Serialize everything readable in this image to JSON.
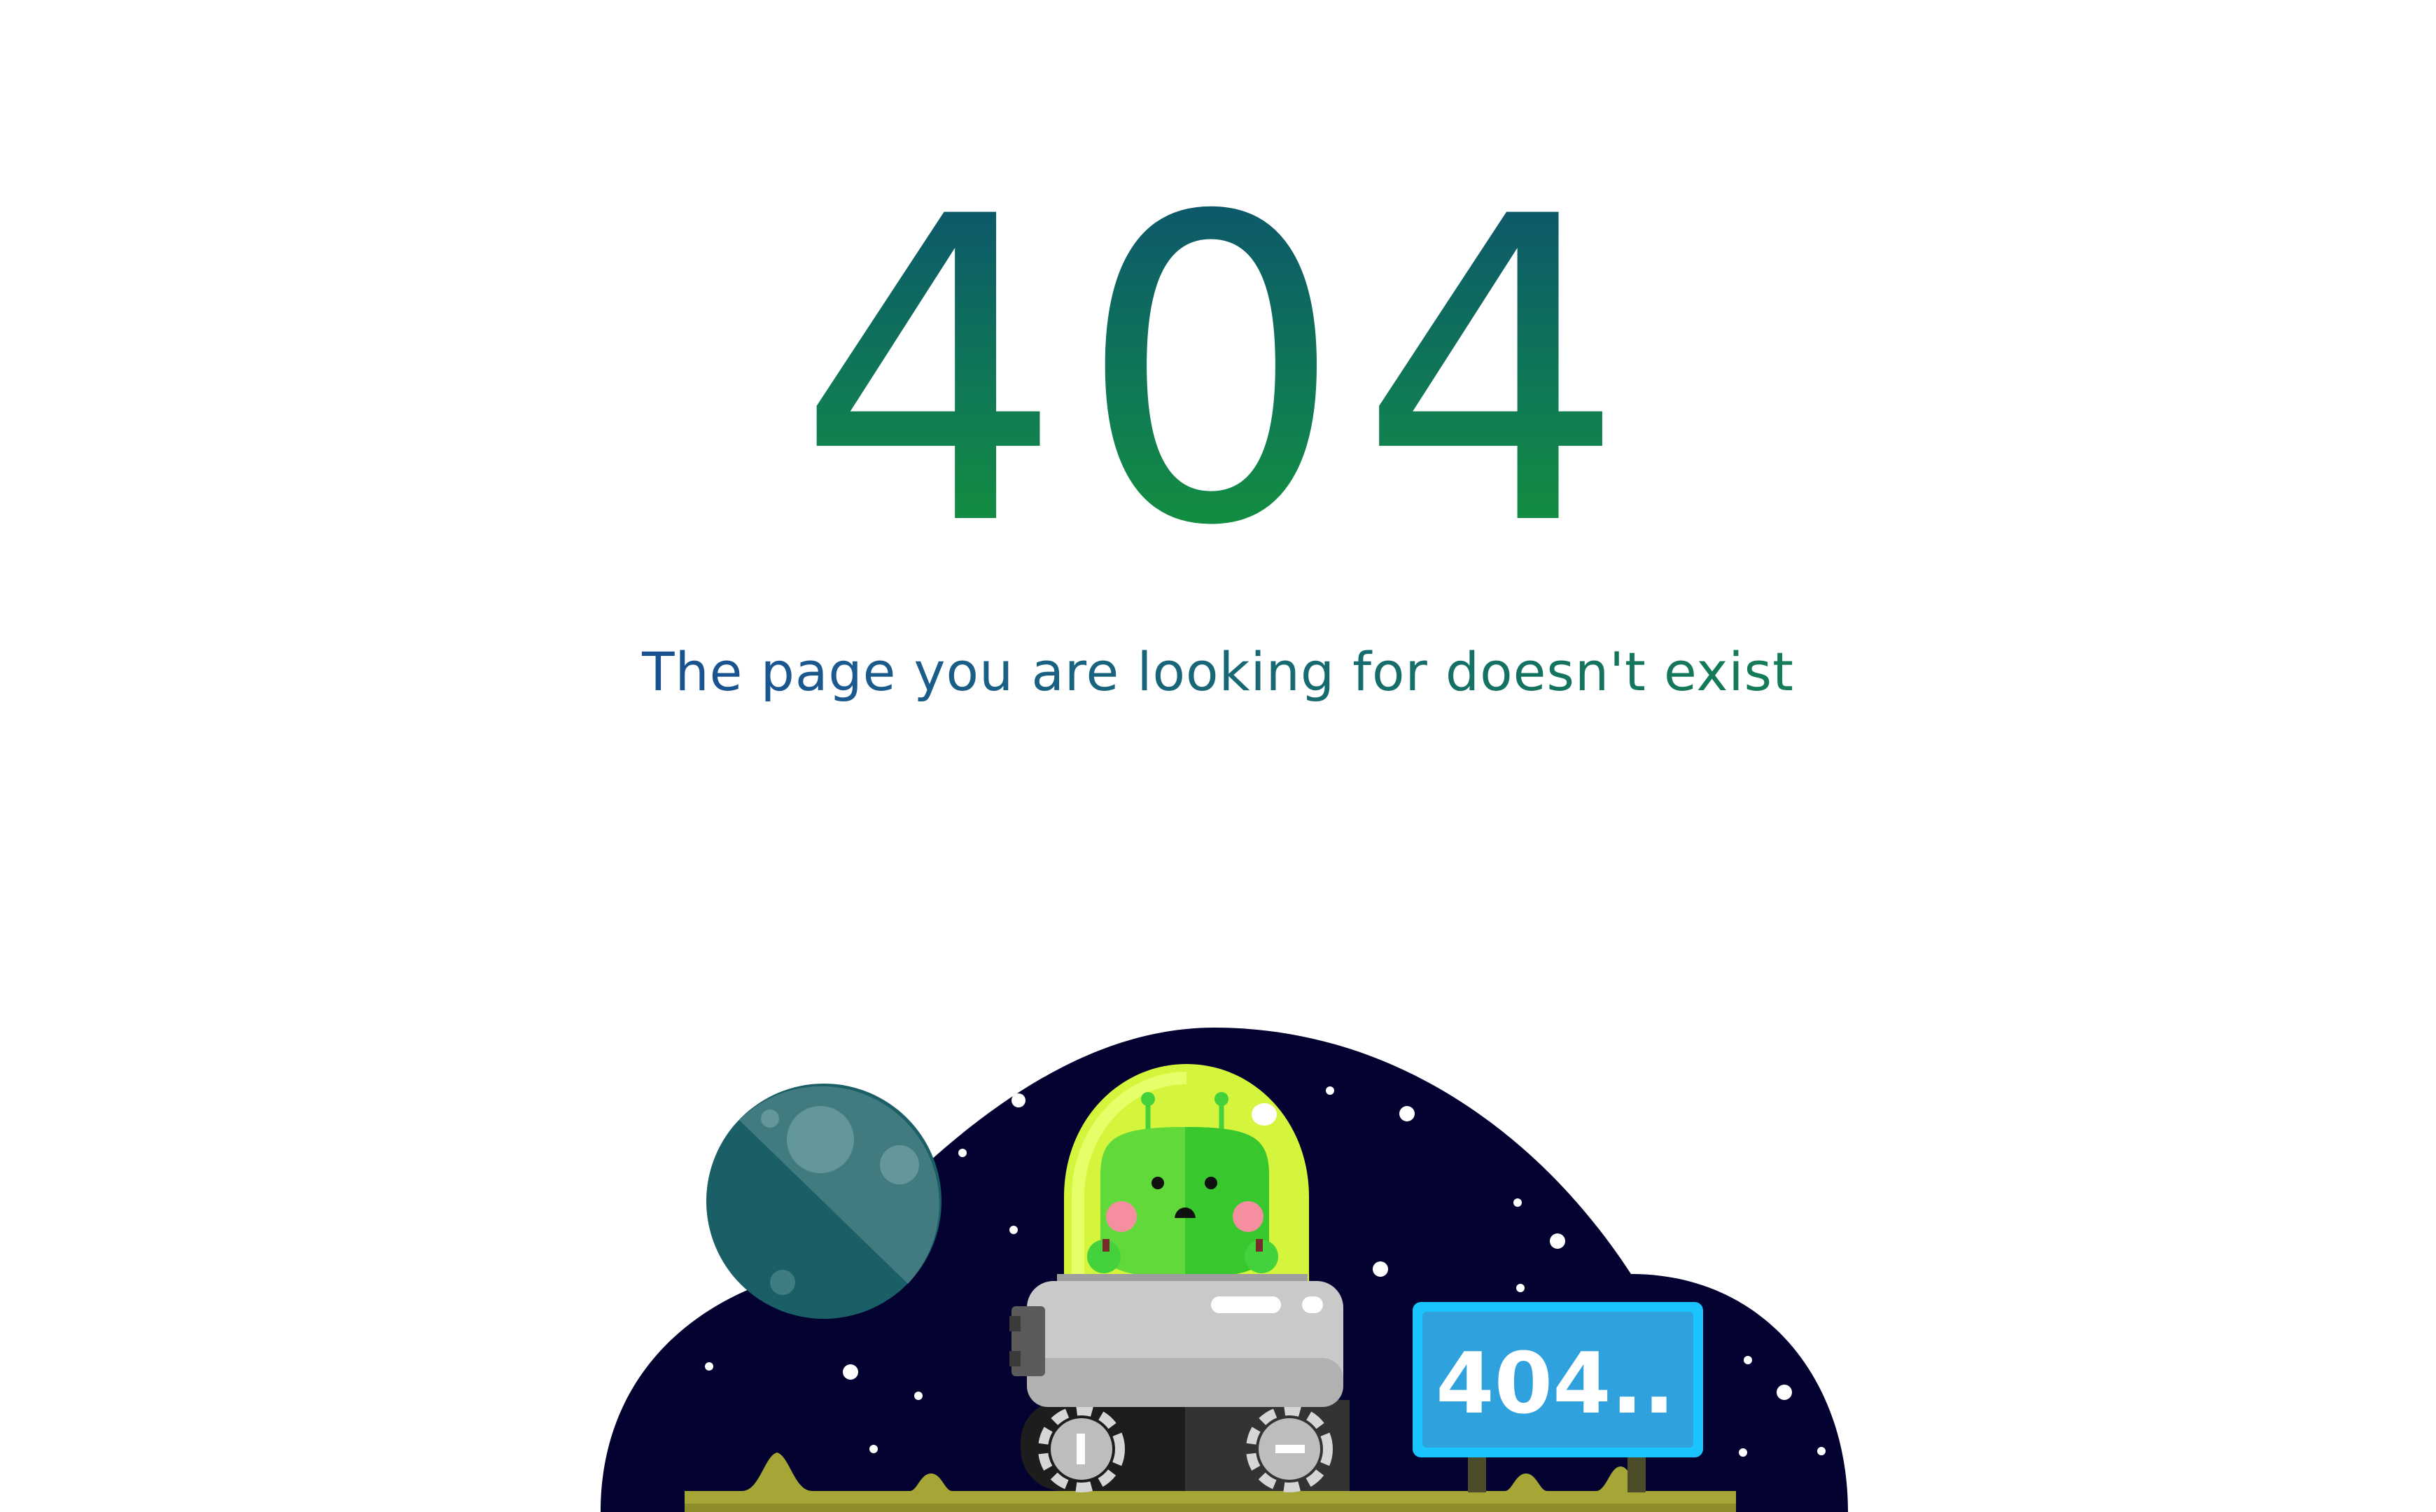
{
  "error": {
    "code": "404",
    "message": "The page you are looking for doesn't exist"
  },
  "illustration": {
    "sign_text": "404..",
    "colors": {
      "code_gradient_top": "#0b4a72",
      "code_gradient_bottom": "#149b31",
      "message_gradient_start": "#13319a",
      "message_gradient_end": "#149447",
      "sky": "#030230",
      "ground": "#a6a637",
      "planet": "#1a5e66",
      "dome": "#d5f53d",
      "alien": "#44d23c",
      "rover_body": "#c9c9c9",
      "sign": "#2fa1dc"
    }
  }
}
